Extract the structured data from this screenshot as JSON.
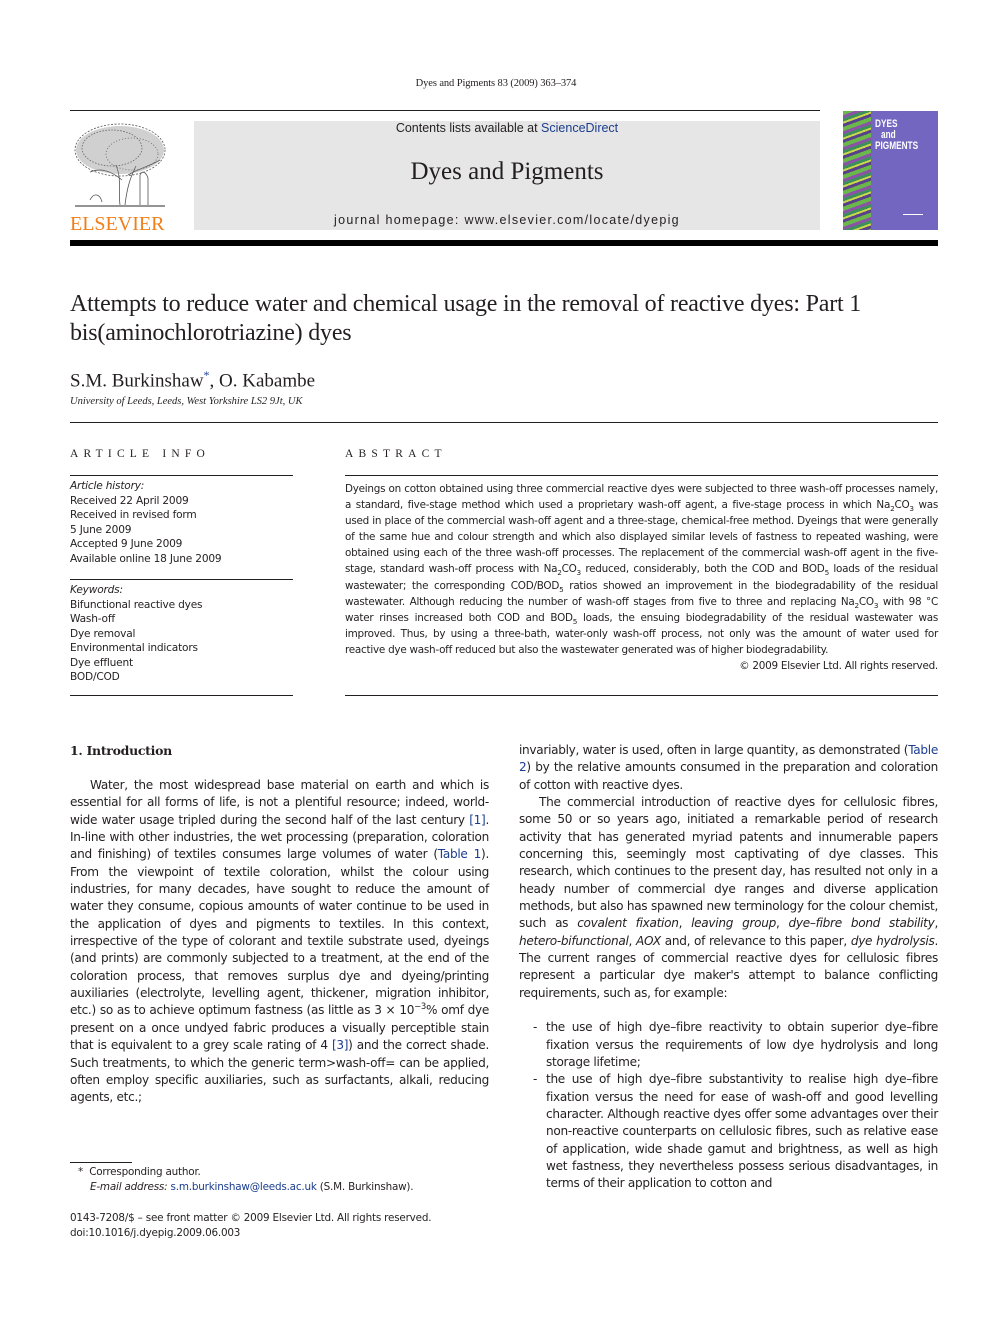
{
  "header": {
    "citation": "Dyes and Pigments 83 (2009) 363–374",
    "contents_prefix": "Contents lists available at ",
    "contents_link": "ScienceDirect",
    "journal_title": "Dyes and Pigments",
    "homepage": "journal homepage: www.elsevier.com/locate/dyepig",
    "publisher_logo_text": "ELSEVIER",
    "cover_title_lines": [
      "DYES",
      "and",
      "PIGMENTS"
    ],
    "colors": {
      "publisher_orange": "#f07f1a",
      "link_blue": "#1b3d8f",
      "banner_gray": "#e6e6e6",
      "cover_purple": "#7266c0"
    }
  },
  "article": {
    "title": "Attempts to reduce water and chemical usage in the removal of reactive dyes: Part 1 bis(aminochlorotriazine) dyes",
    "authors": [
      {
        "name": "S.M. Burkinshaw",
        "marker": "*"
      },
      {
        "name": "O. Kabambe",
        "marker": ""
      }
    ],
    "author_separator": ", ",
    "affiliation": "University of Leeds, Leeds, West Yorkshire LS2 9Jt, UK"
  },
  "article_info": {
    "heading": "ARTICLE INFO",
    "history_label": "Article history:",
    "history": [
      "Received 22 April 2009",
      "Received in revised form",
      "5 June 2009",
      "Accepted 9 June 2009",
      "Available online 18 June 2009"
    ],
    "keywords_label": "Keywords:",
    "keywords": [
      "Bifunctional reactive dyes",
      "Wash-off",
      "Dye removal",
      "Environmental indicators",
      "Dye effluent",
      "BOD/COD"
    ]
  },
  "abstract": {
    "heading": "ABSTRACT",
    "segments": [
      "Dyeings on cotton obtained using three commercial reactive dyes were subjected to three wash-off processes namely, a standard, five-stage method which used a proprietary wash-off agent, a five-stage process in which Na",
      "2",
      "CO",
      "3",
      " was used in place of the commercial wash-off agent and a three-stage, chemical-free method. Dyeings that were generally of the same hue and colour strength and which also displayed similar levels of fastness to repeated washing, were obtained using each of the three wash-off processes. The replacement of the commercial wash-off agent in the five-stage, standard wash-off process with Na",
      "2",
      "CO",
      "3",
      " reduced, considerably, both the COD and BOD",
      "5",
      " loads of the residual wastewater; the corresponding COD/BOD",
      "5",
      " ratios showed an improvement in the biodegradability of the residual wastewater. Although reducing the number of wash-off stages from five to three and replacing Na",
      "2",
      "CO",
      "3",
      " with 98 °C water rinses increased both COD and BOD",
      "5",
      " loads, the ensuing biodegradability of the residual wastewater was improved. Thus, by using a three-bath, water-only wash-off process, not only was the amount of water used for reactive dye wash-off reduced but also the wastewater generated was of higher biodegradability."
    ],
    "copyright": "© 2009 Elsevier Ltd. All rights reserved."
  },
  "body": {
    "section_heading": "1.  Introduction",
    "left_col": {
      "p1_a": "Water, the most widespread base material on earth and which is essential for all forms of life, is not a plentiful resource; indeed, world-wide water usage tripled during the second half of the last century ",
      "ref1": "[1]",
      "p1_b": ". In-line with other industries, the wet processing (preparation, coloration and finishing) of textiles consumes large volumes of water (",
      "table1": "Table 1",
      "p1_c": "). From the viewpoint of textile coloration, whilst the colour using industries, for many decades, have sought to reduce the amount of water they consume, copious amounts of water continue to be used in the application of dyes and pigments to textiles. In this context, irrespective of the type of colorant and textile substrate used, dyeings (and prints) are commonly subjected to a treatment, at the end of the coloration process, that removes surplus dye and dyeing/printing auxiliaries (electrolyte, levelling agent, thickener, migration inhibitor, etc.) so as to achieve optimum fastness (as little as 3 × 10",
      "exp": "−3",
      "p1_d": "% omf dye present on a once undyed fabric produces a visually perceptible stain that is equivalent to a grey scale rating of 4 ",
      "ref3": "[3]",
      "p1_e": ") and the correct shade. Such treatments, to which the generic term>wash-off= can be applied, often employ specific auxiliaries, such as surfactants, alkali, reducing agents, etc.;"
    },
    "right_col": {
      "p1_a": "invariably, water is used, often in large quantity, as demonstrated (",
      "table2": "Table 2",
      "p1_b": ") by the relative amounts consumed in the preparation and coloration of cotton with reactive dyes.",
      "p2_a": "The commercial introduction of reactive dyes for cellulosic fibres, some 50 or so years ago, initiated a remarkable period of research activity that has generated myriad patents and innumerable papers concerning this, seemingly most captivating of dye classes. This research, which continues to the present day, has resulted not only in a heady number of commercial dye ranges and diverse application methods, but also has spawned new terminology for the colour chemist, such as ",
      "term1": "covalent fixation",
      "sep1": ", ",
      "term2": "leaving group",
      "sep2": ", ",
      "term3": "dye–fibre bond stability",
      "sep3": ", ",
      "term4": "hetero-bifunctional",
      "sep4": ", ",
      "term5": "AOX",
      "sep5": " and, of relevance to this paper, ",
      "term6": "dye hydrolysis",
      "p2_b": ". The current ranges of commercial reactive dyes for cellulosic fibres represent a particular dye maker's attempt to balance conflicting requirements, such as, for example:",
      "bullet_marker": "-",
      "bullets": [
        "the use of high dye–fibre reactivity to obtain superior dye–fibre fixation versus the requirements of low dye hydrolysis and long storage lifetime;",
        "the use of high dye–fibre substantivity to realise high dye–fibre fixation versus the need for ease of wash-off and good levelling character. Although reactive dyes offer some advantages over their non-reactive counterparts on cellulosic fibres, such as relative ease of application, wide shade gamut and brightness, as well as high wet fastness, they nevertheless possess serious disadvantages, in terms of their application to cotton and"
      ]
    }
  },
  "footnote": {
    "marker": "*",
    "corresponding": "Corresponding author.",
    "email_label": "E-mail address:",
    "email": "s.m.burkinshaw@leeds.ac.uk",
    "email_owner": " (S.M. Burkinshaw)."
  },
  "imprint": {
    "issn_line": "0143-7208/$ – see front matter © 2009 Elsevier Ltd. All rights reserved.",
    "doi": "doi:10.1016/j.dyepig.2009.06.003"
  }
}
